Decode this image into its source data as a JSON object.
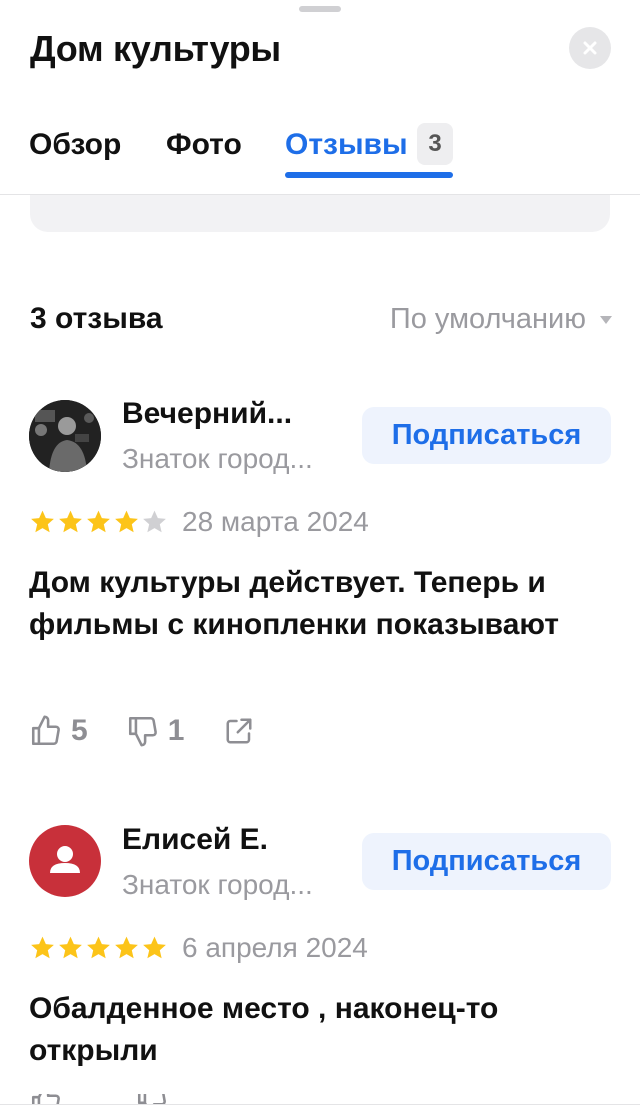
{
  "header": {
    "title": "Дом культуры"
  },
  "tabs": [
    {
      "label": "Обзор",
      "active": false
    },
    {
      "label": "Фото",
      "active": false
    },
    {
      "label": "Отзывы",
      "active": true,
      "count": "3"
    }
  ],
  "reviews_section": {
    "count_label": "3 отзыва",
    "sort_label": "По умолчанию"
  },
  "reviews": [
    {
      "author": "Вечерний...",
      "role": "Знаток город...",
      "subscribe_label": "Подписаться",
      "rating": 4,
      "date": "28 марта 2024",
      "text": "Дом культуры действует. Теперь и фильмы с кинопленки показывают",
      "likes": "5",
      "dislikes": "1"
    },
    {
      "author": "Елисей Е.",
      "role": "Знаток город...",
      "subscribe_label": "Подписаться",
      "rating": 5,
      "date": "6 апреля 2024",
      "text": "Обалденное место , наконец-то открыли"
    }
  ],
  "colors": {
    "accent": "#1e6ee8",
    "star_filled": "#fcc419",
    "star_empty": "#d0d0d3",
    "avatar_red": "#c8303a"
  }
}
